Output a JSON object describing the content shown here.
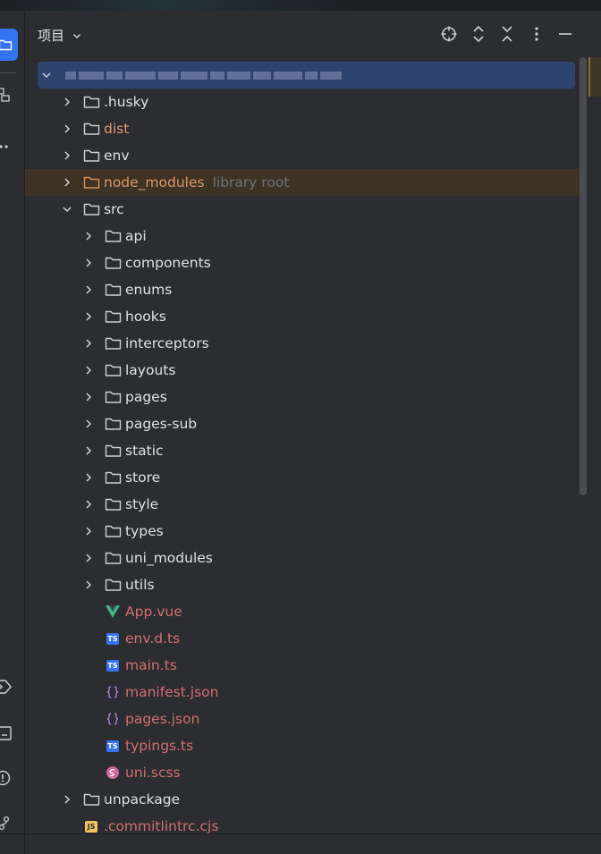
{
  "panel": {
    "title": "项目",
    "colors": {
      "accent": "#3574f0",
      "root_highlight": "#2e436e",
      "excluded": "#e0956a",
      "vcs_modified": "#d36f6f",
      "hint": "#6f737a"
    }
  },
  "header_icons": [
    "locate-icon",
    "expand-collapse-icon",
    "collapse-all-icon",
    "more-options-icon",
    "minimize-icon"
  ],
  "tree": {
    "root": {
      "name_redacted": true
    },
    "items": [
      {
        "label": ".husky",
        "kind": "folder",
        "depth": 1,
        "expanded": false,
        "status": "normal"
      },
      {
        "label": "dist",
        "kind": "folder",
        "depth": 1,
        "expanded": false,
        "status": "excluded"
      },
      {
        "label": "env",
        "kind": "folder",
        "depth": 1,
        "expanded": false,
        "status": "normal"
      },
      {
        "label": "node_modules",
        "hint": "library root",
        "kind": "folder",
        "depth": 1,
        "expanded": false,
        "status": "excluded"
      },
      {
        "label": "src",
        "kind": "folder",
        "depth": 1,
        "expanded": true,
        "status": "normal"
      },
      {
        "label": "api",
        "kind": "folder",
        "depth": 2,
        "expanded": false,
        "status": "normal"
      },
      {
        "label": "components",
        "kind": "folder",
        "depth": 2,
        "expanded": false,
        "status": "normal"
      },
      {
        "label": "enums",
        "kind": "folder",
        "depth": 2,
        "expanded": false,
        "status": "normal"
      },
      {
        "label": "hooks",
        "kind": "folder",
        "depth": 2,
        "expanded": false,
        "status": "normal"
      },
      {
        "label": "interceptors",
        "kind": "folder",
        "depth": 2,
        "expanded": false,
        "status": "normal"
      },
      {
        "label": "layouts",
        "kind": "folder",
        "depth": 2,
        "expanded": false,
        "status": "normal"
      },
      {
        "label": "pages",
        "kind": "folder",
        "depth": 2,
        "expanded": false,
        "status": "normal"
      },
      {
        "label": "pages-sub",
        "kind": "folder",
        "depth": 2,
        "expanded": false,
        "status": "normal"
      },
      {
        "label": "static",
        "kind": "folder",
        "depth": 2,
        "expanded": false,
        "status": "normal"
      },
      {
        "label": "store",
        "kind": "folder",
        "depth": 2,
        "expanded": false,
        "status": "normal"
      },
      {
        "label": "style",
        "kind": "folder",
        "depth": 2,
        "expanded": false,
        "status": "normal"
      },
      {
        "label": "types",
        "kind": "folder",
        "depth": 2,
        "expanded": false,
        "status": "normal"
      },
      {
        "label": "uni_modules",
        "kind": "folder",
        "depth": 2,
        "expanded": false,
        "status": "normal"
      },
      {
        "label": "utils",
        "kind": "folder",
        "depth": 2,
        "expanded": false,
        "status": "normal"
      },
      {
        "label": "App.vue",
        "kind": "vue",
        "depth": 2,
        "status": "vcs"
      },
      {
        "label": "env.d.ts",
        "kind": "ts",
        "depth": 2,
        "status": "vcs"
      },
      {
        "label": "main.ts",
        "kind": "ts",
        "depth": 2,
        "status": "vcs"
      },
      {
        "label": "manifest.json",
        "kind": "json",
        "depth": 2,
        "status": "vcs"
      },
      {
        "label": "pages.json",
        "kind": "json",
        "depth": 2,
        "status": "vcs"
      },
      {
        "label": "typings.ts",
        "kind": "ts",
        "depth": 2,
        "status": "vcs"
      },
      {
        "label": "uni.scss",
        "kind": "sass",
        "depth": 2,
        "status": "vcs"
      },
      {
        "label": "unpackage",
        "kind": "folder",
        "depth": 1,
        "expanded": false,
        "status": "normal"
      },
      {
        "label": ".commitlintrc.cjs",
        "kind": "js",
        "depth": 1,
        "status": "vcs"
      }
    ]
  }
}
